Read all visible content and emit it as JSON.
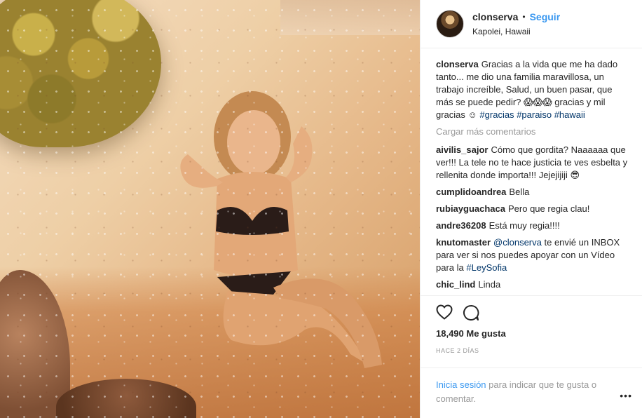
{
  "post": {
    "username": "clonserva",
    "separator": "•",
    "follow_label": "Seguir",
    "location": "Kapolei, Hawaii"
  },
  "caption": {
    "username": "clonserva",
    "text": "Gracias a la vida que me ha dado tanto... me dio una familia maravillosa, un trabajo increíble, Salud, un buen pasar, que más se puede pedir? 😱😱😱 gracias y mil gracias ☺",
    "hashtags": [
      "#gracias",
      "#paraiso",
      "#hawaii"
    ]
  },
  "load_more": "Cargar más comentarios",
  "comments": [
    {
      "user": "aivilis_sajor",
      "text": "Cómo que gordita? Naaaaaa que ver!!! La tele no te hace justicia te ves esbelta y rellenita donde importa!!! Jejejijiji 😎"
    },
    {
      "user": "cumplidoandrea",
      "text": "Bella"
    },
    {
      "user": "rubiayguachaca",
      "text": "Pero que regia clau!"
    },
    {
      "user": "andre36208",
      "text": "Está muy regia!!!!"
    },
    {
      "user": "knutomaster",
      "mention": "@clonserva",
      "text": "te envié un INBOX para ver si nos puedes apoyar con un Vídeo para la",
      "hashtag": "#LeySofia"
    },
    {
      "user": "chic_lind",
      "text": "Linda"
    }
  ],
  "likes": "18,490 Me gusta",
  "time_ago": "HACE 2 DÍAS",
  "footer": {
    "login_link": "Inicia sesión",
    "rest": "para indicar que te gusta o comentar."
  },
  "more_label": "•••",
  "icons": {
    "like": "heart-icon",
    "comment": "comment-icon",
    "more": "more-options-icon"
  }
}
